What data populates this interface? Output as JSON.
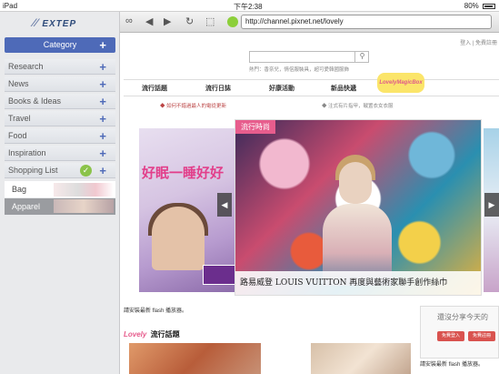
{
  "status_bar": {
    "device": "iPad",
    "time": "下午2:38",
    "battery": "80%"
  },
  "sidebar": {
    "logo": "EXTEP",
    "header": {
      "label": "Category",
      "action": "+"
    },
    "items": [
      {
        "label": "Research",
        "action": "+"
      },
      {
        "label": "News",
        "action": "+"
      },
      {
        "label": "Books & Ideas",
        "action": "+"
      },
      {
        "label": "Travel",
        "action": "+"
      },
      {
        "label": "Food",
        "action": "+"
      },
      {
        "label": "Inspiration",
        "action": "+"
      },
      {
        "label": "Shopping List",
        "action": "+"
      }
    ],
    "sub_items": [
      {
        "label": "Bag"
      },
      {
        "label": "Apparel"
      }
    ]
  },
  "browser": {
    "url": "http://channel.pixnet.net/lovely"
  },
  "page": {
    "login": "登入 | 免費註冊",
    "search_placeholder": "",
    "hot_keywords": "熱門：香奈兒，情侶服裝具，超可愛韓國服飾",
    "tabs": [
      "流行話題",
      "流行日誌",
      "好康活動",
      "新品快遞"
    ],
    "lovely_badge": "LovelyMagicBox",
    "marquee_left": "◆ 如何不錯過最人的電從更新",
    "marquee_right": "◆ 注式有片指甲，戰置衣女衣服",
    "banner_left": {
      "headline": "好眠一睡好好",
      "sub": ""
    },
    "feature": {
      "tag": "流行時尚",
      "caption": "路易威登 LOUIS VUITTON 再度與藝術家聯手創作絲巾"
    },
    "flash_notice": "請安裝最新 flash 播放器。",
    "section": {
      "badge": "Lovely",
      "title": "流行話題"
    },
    "share": {
      "title": "還沒分享今天的",
      "btn1": "免費登入",
      "btn2": "免費註冊"
    },
    "flash_notice_2": "請安裝最新 flash 播放器。"
  }
}
